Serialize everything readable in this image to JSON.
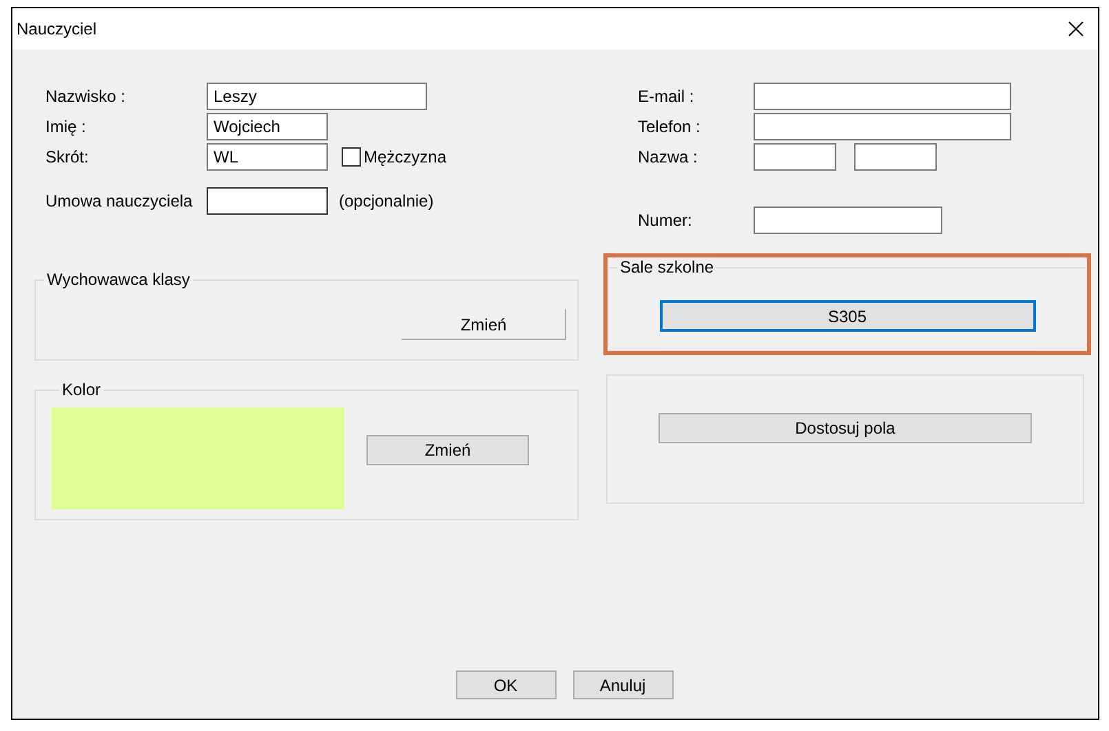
{
  "window": {
    "title": "Nauczyciel"
  },
  "left_fields": [
    {
      "label": "Nazwisko :",
      "value": "Leszy"
    },
    {
      "label": "Imię :",
      "value": "Wojciech"
    },
    {
      "label": "Skrót:",
      "value": "WL"
    }
  ],
  "gender_checkbox": {
    "label": "Mężczyzna",
    "checked": false
  },
  "contract": {
    "label": "Umowa nauczyciela",
    "note": "(opcjonalnie)"
  },
  "right_fields": [
    {
      "label": "E-mail :",
      "inputs": [
        {
          "kind": "wide"
        }
      ]
    },
    {
      "label": "Telefon :",
      "inputs": [
        {
          "kind": "wide"
        }
      ]
    },
    {
      "label": "Nazwa :",
      "inputs": [
        {
          "kind": "short"
        },
        {
          "kind": "short"
        }
      ]
    }
  ],
  "number_field": {
    "label": "Numer:"
  },
  "homeroom_group": {
    "title": "Wychowawca klasy",
    "button": "Zmień"
  },
  "color_group": {
    "title": "Kolor",
    "color": "#dcfe92",
    "button": "Zmień"
  },
  "rooms_group": {
    "title": "Sale szkolne",
    "button": "S305",
    "highlighted": true
  },
  "fields_group": {
    "button": "Dostosuj pola"
  },
  "buttons": [
    "OK",
    "Anuluj"
  ]
}
